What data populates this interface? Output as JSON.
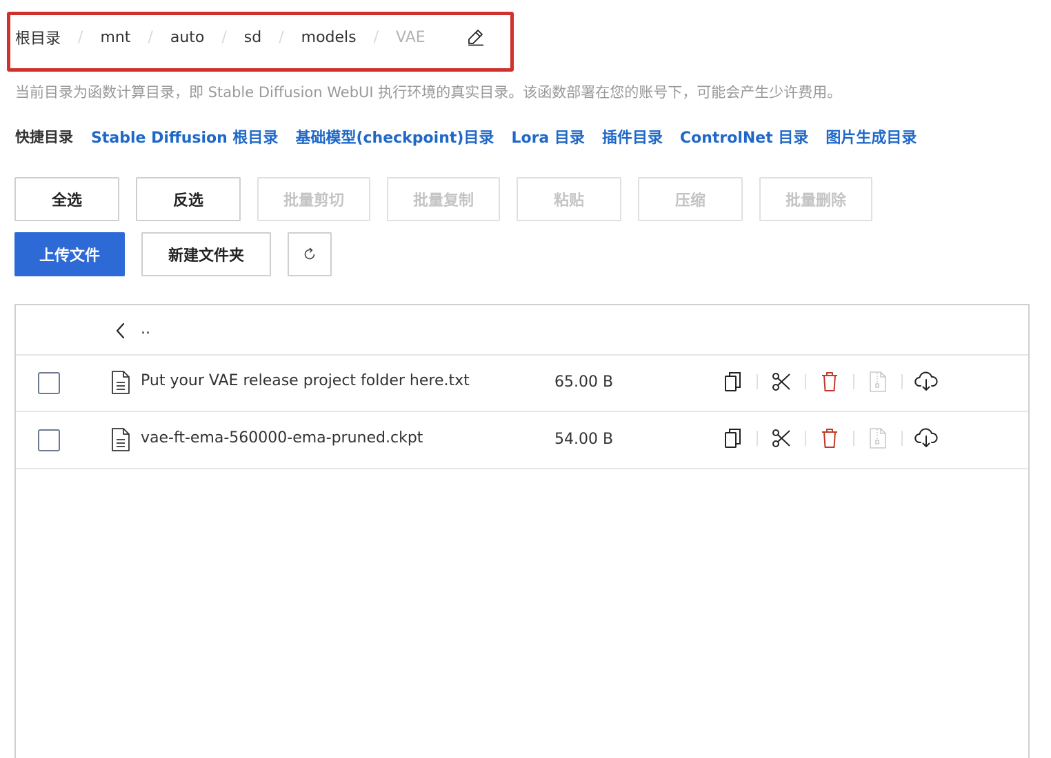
{
  "breadcrumb": {
    "items": [
      "根目录",
      "mnt",
      "auto",
      "sd",
      "models",
      "VAE"
    ],
    "separator": "/"
  },
  "hint": "当前目录为函数计算目录，即 Stable Diffusion WebUI 执行环境的真实目录。该函数部署在您的账号下，可能会产生少许费用。",
  "quick": {
    "label": "快捷目录",
    "links": [
      "Stable Diffusion 根目录",
      "基础模型(checkpoint)目录",
      "Lora 目录",
      "插件目录",
      "ControlNet 目录",
      "图片生成目录"
    ]
  },
  "toolbar": {
    "select_all": "全选",
    "invert": "反选",
    "batch_cut": "批量剪切",
    "batch_copy": "批量复制",
    "paste": "粘贴",
    "compress": "压缩",
    "batch_delete": "批量删除",
    "upload": "上传文件",
    "new_folder": "新建文件夹"
  },
  "list": {
    "parent": "..",
    "files": [
      {
        "name": "Put your VAE release project folder here.txt",
        "size": "65.00 B"
      },
      {
        "name": "vae-ft-ema-560000-ema-pruned.ckpt",
        "size": "54.00 B"
      }
    ]
  },
  "colors": {
    "accent": "#2d6ad6",
    "link": "#1f68c8",
    "danger": "#c0392b",
    "highlight_box": "#d0312d"
  }
}
